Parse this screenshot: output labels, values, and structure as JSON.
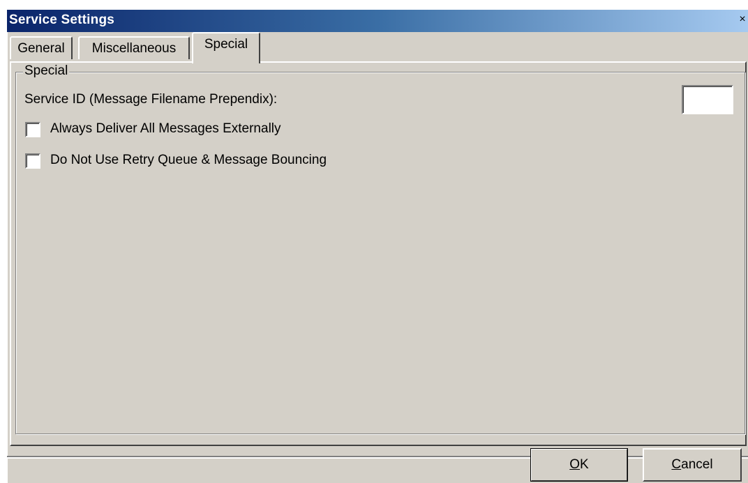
{
  "window": {
    "title": "Service Settings",
    "close_glyph": "×"
  },
  "tabs": [
    {
      "label": "General",
      "active": false
    },
    {
      "label": "Miscellaneous",
      "active": false
    },
    {
      "label": "Special",
      "active": true
    }
  ],
  "group": {
    "title": "Special",
    "service_id": {
      "label": "Service ID (Message Filename Prependix):",
      "value": ""
    },
    "checkboxes": [
      {
        "label": "Always Deliver All Messages Externally",
        "checked": false
      },
      {
        "label": "Do Not Use Retry Queue & Message Bouncing",
        "checked": false
      }
    ]
  },
  "buttons": {
    "ok_accel": "O",
    "ok_rest": "K",
    "cancel_accel": "C",
    "cancel_rest": "ancel"
  },
  "colors": {
    "face": "#d4d0c8",
    "titlebar_start": "#0a246a",
    "titlebar_end": "#a6caf0"
  }
}
